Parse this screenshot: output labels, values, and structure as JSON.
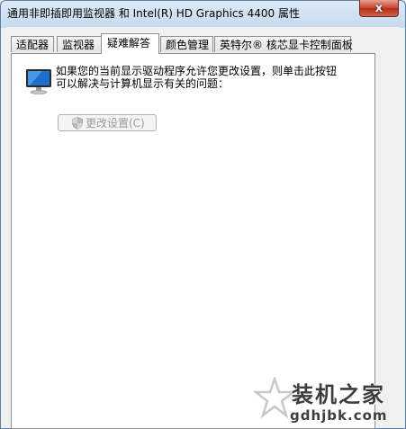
{
  "window": {
    "title": "通用非即插即用监视器 和 Intel(R) HD Graphics 4400 属性",
    "close_label": "x"
  },
  "tabs": [
    {
      "label": "适配器",
      "active": false
    },
    {
      "label": "监视器",
      "active": false
    },
    {
      "label": "疑难解答",
      "active": true
    },
    {
      "label": "颜色管理",
      "active": false
    },
    {
      "label": "英特尔® 核芯显卡控制面板",
      "active": false
    }
  ],
  "panel": {
    "description_line1": "如果您的当前显示驱动程序允许您更改设置，则单击此按钮",
    "description_line2": "可以解决与计算机显示有关的问题：",
    "change_settings_button": "更改设置(C)",
    "change_settings_enabled": false
  },
  "watermark": {
    "text": "装机之家",
    "url": "gdhjbk.com"
  },
  "icons": {
    "monitor": "monitor-icon",
    "shield": "uac-shield-icon",
    "close": "close-icon",
    "watermark_star": "star-logo-icon"
  }
}
